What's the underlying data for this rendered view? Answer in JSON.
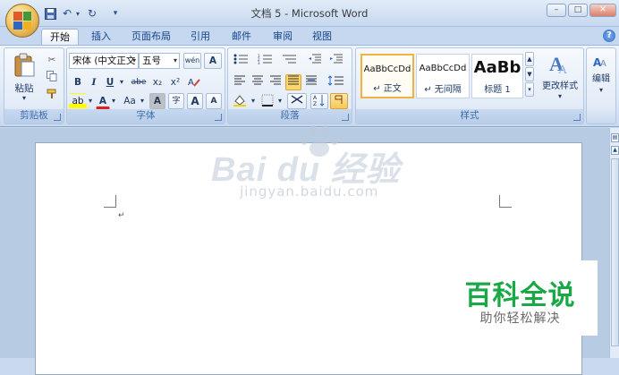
{
  "titlebar": {
    "title": "文档 5 - Microsoft Word",
    "quick_access": {
      "save": "save-icon",
      "undo": "↶",
      "redo": "↻",
      "customize": "▾"
    },
    "window_controls": {
      "minimize": "–",
      "restore": "□",
      "close": "✕"
    }
  },
  "tabs": [
    {
      "label": "开始",
      "active": true
    },
    {
      "label": "插入"
    },
    {
      "label": "页面布局"
    },
    {
      "label": "引用"
    },
    {
      "label": "邮件"
    },
    {
      "label": "审阅"
    },
    {
      "label": "视图"
    }
  ],
  "ribbon": {
    "clipboard": {
      "label": "剪贴板",
      "paste_label": "粘贴",
      "paste_arrow": "▾"
    },
    "font": {
      "label": "字体",
      "font_name": "宋体 (中文正文",
      "font_size": "五号",
      "bold": "B",
      "italic": "I",
      "underline": "U",
      "strikethrough": "abe",
      "subscript": "x₂",
      "superscript": "x²",
      "change_case": "Aa",
      "grow": "A",
      "shrink": "A",
      "phonetic": "wén",
      "border_char": "A",
      "shade_char": "A",
      "enclose": "字",
      "highlight": "ab",
      "font_color": "A"
    },
    "paragraph": {
      "label": "段落"
    },
    "styles": {
      "label": "样式",
      "tiles": [
        {
          "sample": "AaBbCcDd",
          "name": "↵ 正文",
          "selected": true
        },
        {
          "sample": "AaBbCcDd",
          "name": "↵ 无间隔"
        },
        {
          "sample": "AaBb",
          "name": "标题 1"
        }
      ],
      "change_styles_label": "更改样式"
    },
    "editing": {
      "label": "编辑"
    }
  },
  "document": {
    "paragraph_mark": "↵"
  },
  "watermark": {
    "logo": "Bai du 经验",
    "url": "jingyan.baidu.com"
  },
  "badge": {
    "main": "百科全说",
    "sub": "助你轻松解决"
  },
  "help": "?"
}
